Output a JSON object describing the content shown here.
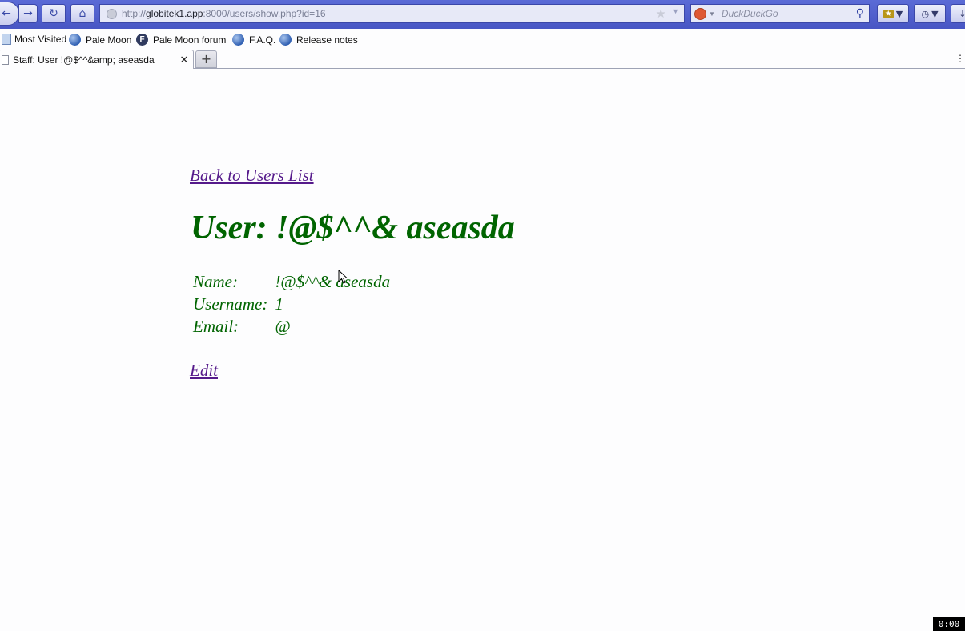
{
  "browser": {
    "url_prefix": "http://",
    "url_host": "globitek1.app",
    "url_rest": ":8000/users/show.php?id=16",
    "search_placeholder": "DuckDuckGo",
    "bookmarks": [
      "Most Visited",
      "Pale Moon",
      "Pale Moon forum",
      "F.A.Q.",
      "Release notes"
    ],
    "tab_title": "Staff: User !@$^^&amp; aseasda",
    "new_tab_symbol": "+"
  },
  "page": {
    "back_link": "Back to Users List",
    "title": "User: !@$^^& aseasda",
    "details": [
      {
        "label": "Name:",
        "value": "!@$^^& aseasda"
      },
      {
        "label": "Username:",
        "value": "1"
      },
      {
        "label": "Email:",
        "value": "@"
      }
    ],
    "edit_link": "Edit"
  },
  "overlay": {
    "timer": "0:00"
  },
  "colors": {
    "heading": "#006400",
    "link": "#551a8b",
    "toolbar": "#4856c4"
  },
  "icons": [
    "back-arrow-icon",
    "forward-arrow-icon",
    "reload-icon",
    "home-icon",
    "star-icon",
    "magnifier-icon",
    "globe-icon",
    "close-icon",
    "mouse-cursor-icon"
  ]
}
